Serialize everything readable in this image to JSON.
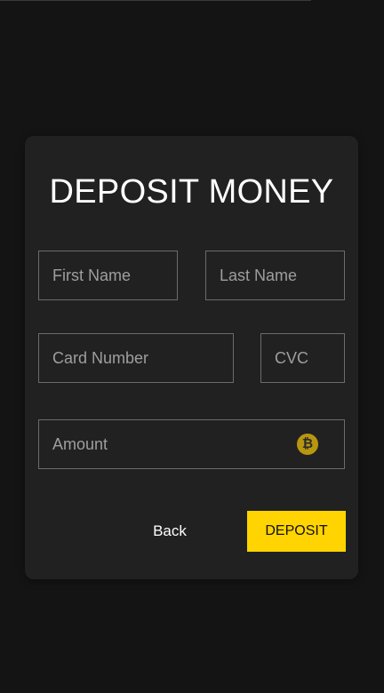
{
  "form": {
    "title": "DEPOSIT MONEY",
    "first_name_placeholder": "First Name",
    "last_name_placeholder": "Last Name",
    "card_number_placeholder": "Card Number",
    "cvc_placeholder": "CVC",
    "amount_placeholder": "Amount",
    "currency_icon": "bitcoin-icon",
    "currency_symbol": "₿",
    "back_label": "Back",
    "deposit_label": "DEPOSIT"
  },
  "colors": {
    "background": "#141414",
    "card": "#212121",
    "accent": "#ffd400",
    "coin": "#b8960f"
  }
}
